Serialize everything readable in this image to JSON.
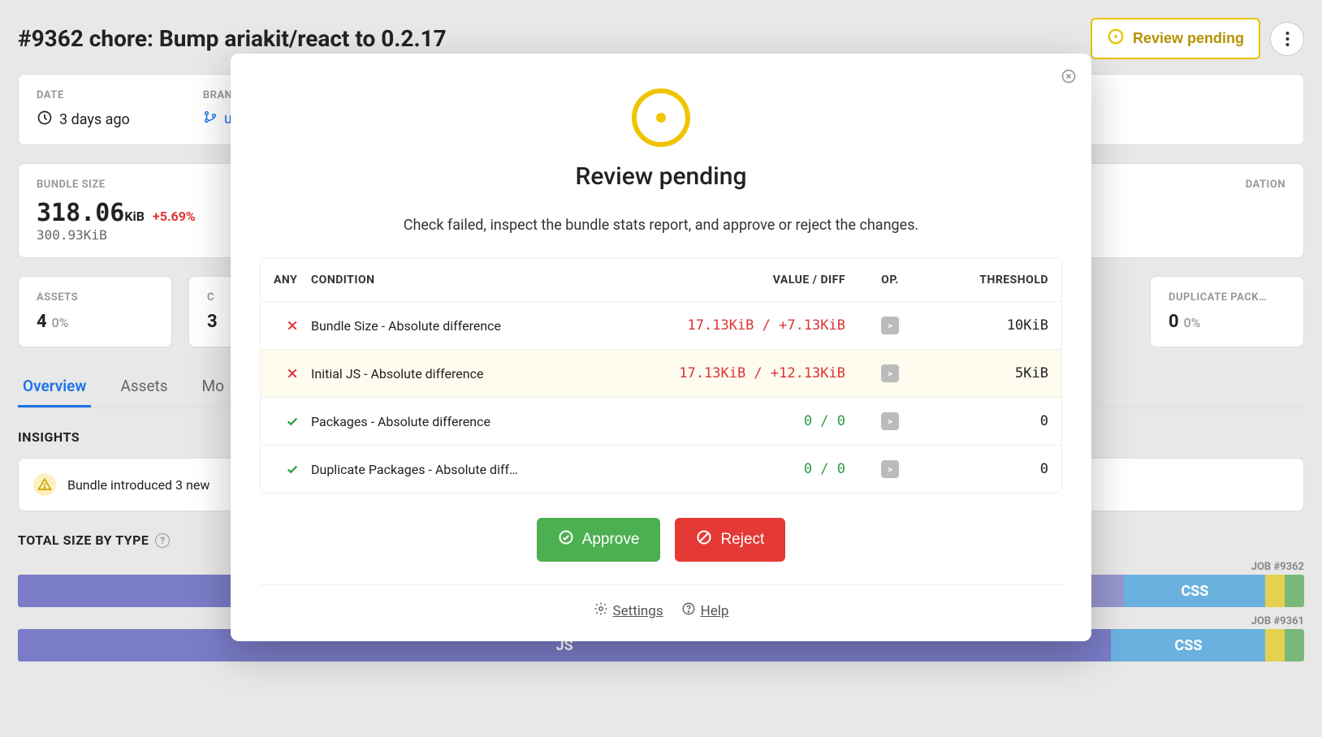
{
  "header": {
    "title": "#9362 chore: Bump ariakit/react to 0.2.17",
    "review_btn": "Review pending"
  },
  "meta": {
    "date_label": "DATE",
    "date_value": "3 days ago",
    "branch_label": "BRANCH",
    "branch_value": "upgr"
  },
  "bundle": {
    "label": "BUNDLE SIZE",
    "value": "318.06",
    "unit": "KiB",
    "delta": "+5.69%",
    "baseline": "300.93KiB",
    "cache_label": "DATION"
  },
  "small_metrics": [
    {
      "label": "ASSETS",
      "value": "4",
      "pct": "0%"
    },
    {
      "label": "C",
      "value": "3"
    },
    {
      "label": "DUPLICATE PACK…",
      "value": "0",
      "pct": "0%"
    }
  ],
  "tabs": {
    "overview": "Overview",
    "assets": "Assets",
    "modules": "Mo"
  },
  "insights": {
    "heading": "INSIGHTS",
    "text": "Bundle introduced 3 new",
    "total_size_heading": "TOTAL SIZE BY TYPE"
  },
  "bars": [
    {
      "job": "JOB #9362",
      "segments": [
        {
          "label": "",
          "cls": "seg-js",
          "w": 71
        },
        {
          "label": "",
          "cls": "seg-js",
          "w": 15,
          "light": true
        },
        {
          "label": "CSS",
          "cls": "seg-css",
          "w": 11
        },
        {
          "label": "",
          "cls": "seg-y",
          "w": 1.5
        },
        {
          "label": "",
          "cls": "seg-g",
          "w": 1.5
        }
      ]
    },
    {
      "job": "JOB #9361",
      "segments": [
        {
          "label": "JS",
          "cls": "seg-js",
          "w": 85
        },
        {
          "label": "CSS",
          "cls": "seg-css",
          "w": 12
        },
        {
          "label": "",
          "cls": "seg-y",
          "w": 1.5
        },
        {
          "label": "",
          "cls": "seg-g",
          "w": 1.5
        }
      ]
    }
  ],
  "modal": {
    "title": "Review pending",
    "desc": "Check failed, inspect the bundle stats report, and approve or reject the changes.",
    "head": {
      "any": "ANY",
      "condition": "CONDITION",
      "value": "VALUE / DIFF",
      "op": "OP.",
      "threshold": "THRESHOLD"
    },
    "rows": [
      {
        "status": "fail",
        "name": "Bundle Size - Absolute difference",
        "value": "17.13KiB / +7.13KiB",
        "op": ">",
        "threshold": "10KiB"
      },
      {
        "status": "fail2",
        "name": "Initial JS - Absolute difference",
        "value": "17.13KiB / +12.13KiB",
        "op": ">",
        "threshold": "5KiB"
      },
      {
        "status": "pass",
        "name": "Packages - Absolute difference",
        "value": "0 / 0",
        "op": ">",
        "threshold": "0"
      },
      {
        "status": "pass",
        "name": "Duplicate Packages - Absolute diff…",
        "value": "0 / 0",
        "op": ">",
        "threshold": "0"
      }
    ],
    "approve": "Approve",
    "reject": "Reject",
    "settings": "Settings",
    "help": "Help"
  }
}
